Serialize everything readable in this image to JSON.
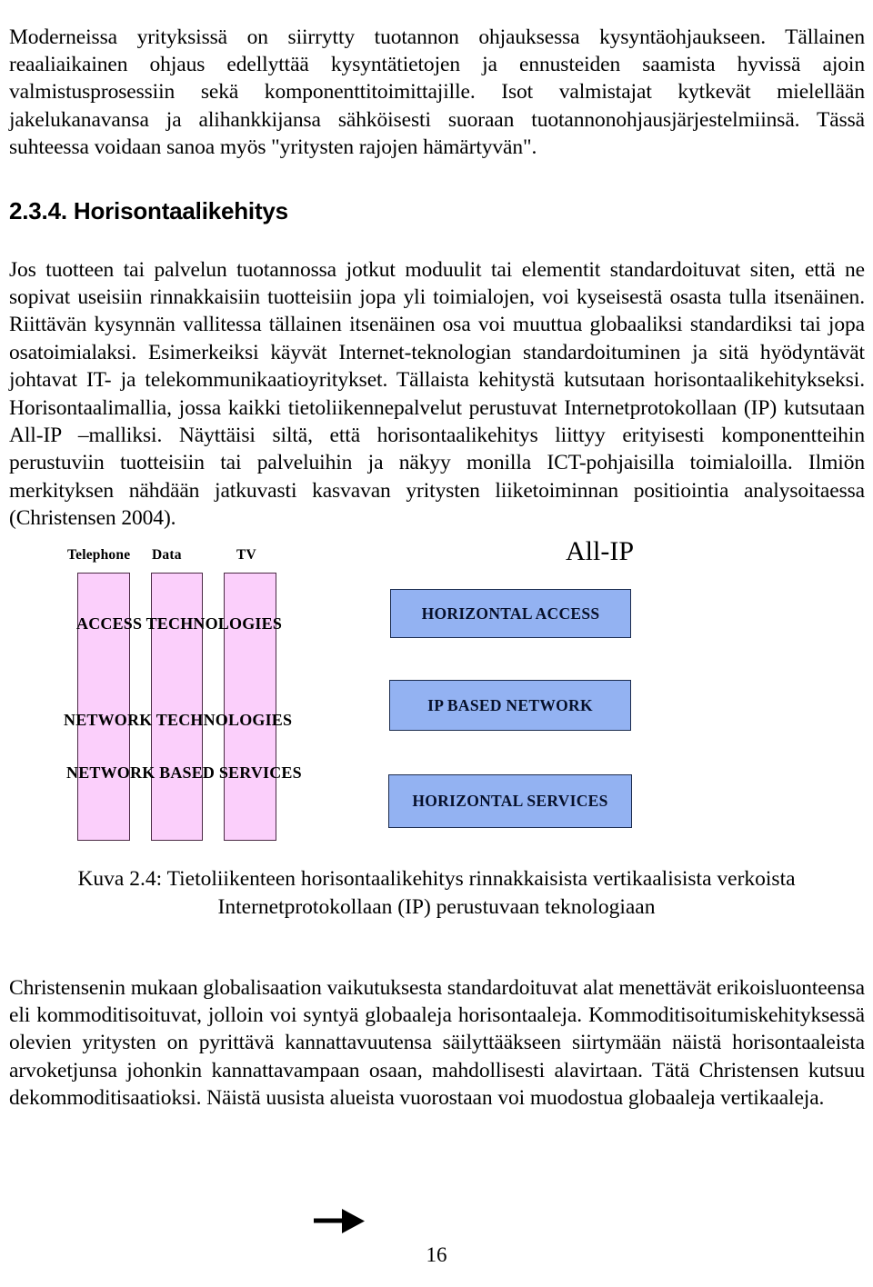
{
  "document": {
    "page_number": "16",
    "section": {
      "number": "2.3.4.",
      "title": "Horisontaalikehitys",
      "heading_full": "2.3.4. Horisontaalikehitys"
    },
    "paragraphs": {
      "intro": "Moderneissa yrityksissä on siirrytty tuotannon ohjauksessa kysyntäohjaukseen. Tällainen reaaliaikainen ohjaus edellyttää kysyntätietojen ja ennusteiden saamista hyvissä ajoin valmistusprosessiin sekä komponenttitoimittajille. Isot valmistajat kytkevät mielellään jakelukanavansa ja alihankkijansa sähköisesti suoraan tuotannonohjausjärjestelmiinsä. Tässä suhteessa voidaan sanoa myös \"yritysten rajojen hämärtyvän\".",
      "horisontaalikehitys": "Jos tuotteen tai palvelun tuotannossa jotkut moduulit tai elementit standardoituvat siten, että ne sopivat useisiin rinnakkaisiin tuotteisiin jopa yli toimialojen, voi kyseisestä osasta tulla itsenäinen. Riittävän kysynnän vallitessa tällainen itsenäinen osa voi muuttua globaaliksi standardiksi tai jopa osatoimialaksi. Esimerkeiksi käyvät Internet-teknologian standardoituminen ja sitä hyödyntävät johtavat IT- ja telekommunikaatioyritykset. Tällaista kehitystä kutsutaan horisontaalikehitykseksi. Horisontaalimallia, jossa kaikki tietoliikennepalvelut perustuvat Internetprotokollaan (IP) kutsutaan All-IP –malliksi. Näyttäisi siltä, että horisontaalikehitys liittyy erityisesti komponentteihin perustuviin tuotteisiin tai palveluihin ja näkyy monilla ICT-pohjaisilla toimialoilla. Ilmiön merkityksen nähdään jatkuvasti kasvavan yritysten liiketoiminnan positiointia analysoitaessa (Christensen 2004).",
      "christensen": "Christensenin mukaan globalisaation vaikutuksesta standardoituvat alat menettävät erikoisluonteensa eli kommoditisoituvat, jolloin voi syntyä globaaleja horisontaaleja. Kommoditisoitumiskehityksessä olevien yritysten on pyrittävä kannattavuutensa säilyttääkseen siirtymään näistä horisontaaleista arvoketjunsa johonkin kannattavampaan osaan, mahdollisesti alavirtaan.  Tätä Christensen kutsuu dekommoditisaatioksi. Näistä uusista alueista vuorostaan voi muodostua globaaleja vertikaaleja."
    },
    "figure": {
      "caption_line1": "Kuva 2.4: Tietoliikenteen horisontaalikehitys rinnakkaisista vertikaalisista",
      "caption_line2": "verkoista Internetprotokollaan (IP) perustuvaan teknologiaan",
      "right_title": "All-IP",
      "vertical_columns": [
        {
          "label": "Telephone"
        },
        {
          "label": "Data"
        },
        {
          "label": "TV"
        }
      ],
      "layer_labels": [
        "ACCESS TECHNOLOGIES",
        "NETWORK TECHNOLOGIES",
        "NETWORK BASED SERVICES"
      ],
      "horizontal_boxes": [
        "HORIZONTAL ACCESS",
        "IP BASED NETWORK",
        "HORIZONTAL SERVICES"
      ],
      "colors": {
        "vertical_fill": "#FBCFFB",
        "vertical_border": "#4a2a44",
        "horizontal_fill": "#93B2F2",
        "horizontal_border": "#1b2b4d",
        "arrow": "#000000"
      }
    }
  }
}
